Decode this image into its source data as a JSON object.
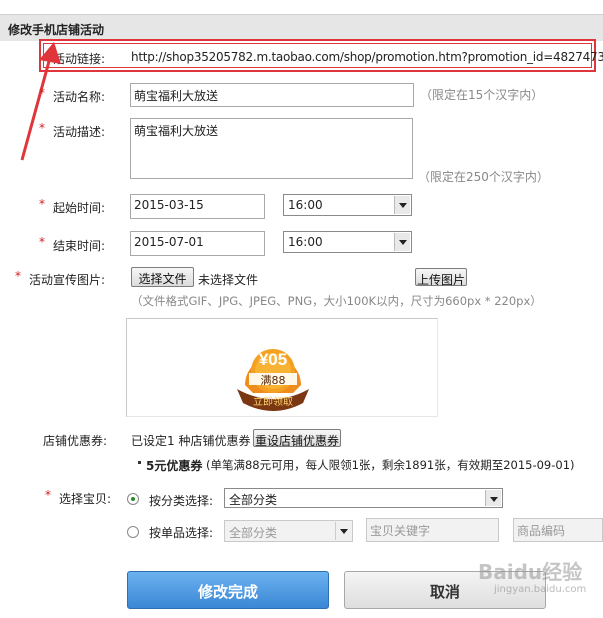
{
  "header": {
    "title": "修改手机店铺活动"
  },
  "link": {
    "label": "活动链接:",
    "url": "http://shop35205782.m.taobao.com/shop/promotion.htm?promotion_id=4827473"
  },
  "name": {
    "label": "活动名称:",
    "value": "萌宝福利大放送",
    "hint": "（限定在15个汉字内）"
  },
  "desc": {
    "label": "活动描述:",
    "value": "萌宝福利大放送",
    "hint": "（限定在250个汉字内）"
  },
  "start": {
    "label": "起始时间:",
    "date": "2015-03-15",
    "time": "16:00"
  },
  "end": {
    "label": "结束时间:",
    "date": "2015-07-01",
    "time": "16:00"
  },
  "image": {
    "label": "活动宣传图片:",
    "choose_btn": "选择文件",
    "no_file": "未选择文件",
    "upload_btn": "上传图片",
    "hint": "（文件格式GIF、JPG、JPEG、PNG，大小100K以内，尺寸为660px * 220px）",
    "badge_top": "¥05",
    "badge_mid": "满88",
    "badge_ribbon": "立即领取"
  },
  "coupon": {
    "label": "店铺优惠券:",
    "status": "已设定1 种店铺优惠券",
    "reset_btn": "重设店铺优惠券",
    "item_title": "5元优惠券",
    "item_detail": "(单笔满88元可用，每人限领1张，剩余1891张，有效期至2015-09-01)"
  },
  "goods": {
    "label": "选择宝贝:",
    "by_category": "按分类选择:",
    "category_value": "全部分类",
    "by_item": "按单品选择:",
    "item_value": "全部分类",
    "keyword_placeholder": "宝贝关键字",
    "code_placeholder": "商品编码"
  },
  "actions": {
    "submit": "修改完成",
    "cancel": "取消"
  },
  "watermark": {
    "line1": "Baidu经验",
    "line2": "jingyan.baidu.com"
  },
  "colors": {
    "accent_blue": "#3d8fd8",
    "required_red": "#d02020",
    "annotation_red": "#e0353a"
  }
}
